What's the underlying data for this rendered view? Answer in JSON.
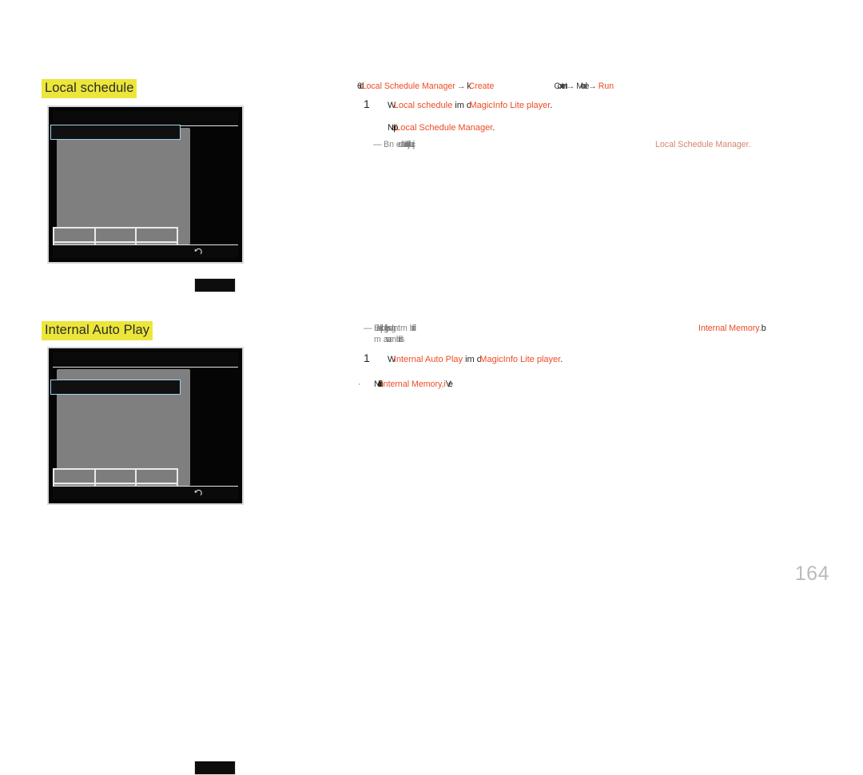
{
  "page": {
    "number": "164"
  },
  "sections": [
    {
      "heading": "Local schedule",
      "mockup": {
        "name": "local-schedule-screen",
        "return_icon": "return-arrow-icon"
      },
      "breadcrumb": {
        "overlap_prefix": "6d",
        "item1": "Local Schedule Manager",
        "arrow1": "→",
        "overlap_mid": "k",
        "item2": "Create",
        "overlap_tail1": "Content",
        "arrow2": "→",
        "overlap_tail2": "Mode",
        "arrow3": "→",
        "item3": "Run"
      },
      "steps": [
        {
          "number": "1",
          "overlap_lead": "W",
          "red1": "Local schedule",
          "mid": "im",
          "overlap_mid": "d",
          "red2": "MagicInfo Lite player",
          "tail": "."
        }
      ],
      "sub_lines": [
        {
          "overlap_lead": "Natrip",
          "red": "Local Schedule Manager",
          "tail": "."
        }
      ],
      "notes": [
        {
          "dash": "—",
          "grey_lead": "Bn",
          "grey_overlap": "edableldjtabcji"
        }
      ],
      "right_note": {
        "text": "Local Schedule Manager.",
        "color": "#d8846c"
      }
    },
    {
      "heading": "Internal Auto Play",
      "mockup": {
        "name": "internal-auto-play-screen",
        "return_icon": "return-arrow-icon"
      },
      "notes": [
        {
          "dash": "—",
          "grey_overlap_line1": "Eladjkdgjhsdgn",
          "grey_mid1": "tm",
          "grey_tail1": "bfdi",
          "grey_line2_a": "m",
          "grey_line2_b": "asam",
          "grey_line2_c": "bfds"
        }
      ],
      "right_note": {
        "text": "Internal Memory.",
        "overlap_tail": "b",
        "color": "#ed4b24"
      },
      "steps": [
        {
          "number": "1",
          "overlap_lead": "W",
          "red1": "Internal Auto Play",
          "mid": "im",
          "overlap_mid": "d",
          "red2": "MagicInfo Lite player",
          "tail": "."
        }
      ],
      "bullets": [
        {
          "dot": "·",
          "overlap_lead": "Ndith",
          "red": "Internal Memory",
          "mid": ",i",
          "overlap_tail": "Ve"
        }
      ]
    }
  ],
  "colors": {
    "accent_red": "#ed4b24",
    "highlight_yellow": "#ece63a",
    "text_black": "#231f20",
    "text_grey": "#808285",
    "page_number_grey": "#b9bbbd",
    "mock_panel_grey": "#7f7f7f",
    "mock_select_blue": "#9fd2ec"
  }
}
